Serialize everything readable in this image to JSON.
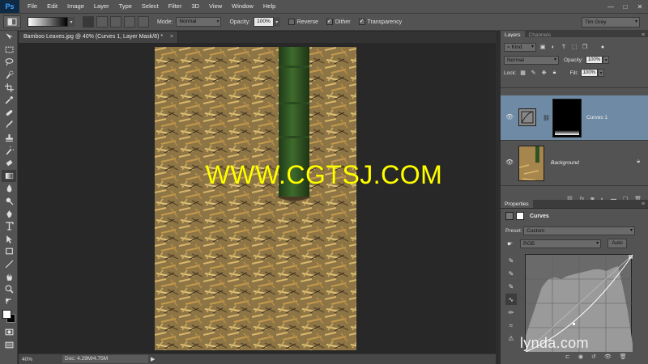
{
  "app": {
    "logo": "Ps",
    "menus": [
      "File",
      "Edit",
      "Image",
      "Layer",
      "Type",
      "Select",
      "Filter",
      "3D",
      "View",
      "Window",
      "Help"
    ],
    "window_controls": [
      "—",
      "□",
      "✕"
    ]
  },
  "options_bar": {
    "mode_label": "Mode:",
    "mode_value": "Normal",
    "opacity_label": "Opacity:",
    "opacity_value": "100%",
    "reverse_label": "Reverse",
    "reverse_checked": false,
    "dither_label": "Dither",
    "dither_checked": true,
    "transparency_label": "Transparency",
    "transparency_checked": true,
    "workspace": "Tim Grey"
  },
  "document": {
    "tab_title": "Bamboo Leaves.jpg @ 40% (Curves 1, Layer Mask/8) *",
    "tab_close": "×",
    "zoom": "40%",
    "doc_size": "Doc: 4.29M/4.75M",
    "status_arrow": "▶"
  },
  "watermark": "WWW.CGTSJ.COM",
  "colors": {
    "foreground": "#ffffff",
    "background": "#000000",
    "selected_layer": "#6f8aa5",
    "watermark": "#ffff00"
  },
  "layers_panel": {
    "tabs": [
      "Layers",
      "Channels"
    ],
    "filter_kind": "Kind",
    "blend_mode": "Normal",
    "opacity_label": "Opacity:",
    "opacity_value": "100%",
    "lock_label": "Lock:",
    "fill_label": "Fill:",
    "fill_value": "100%",
    "layers": [
      {
        "name": "Curves 1",
        "visible": true,
        "selected": true
      },
      {
        "name": "Background",
        "visible": true,
        "selected": false,
        "locked": true
      }
    ],
    "footer_icons": [
      "link-icon",
      "fx-icon",
      "mask-icon",
      "adjustment-icon",
      "folder-icon",
      "new-layer-icon",
      "trash-icon"
    ]
  },
  "properties_panel": {
    "tab": "Properties",
    "title": "Curves",
    "preset_label": "Preset:",
    "preset_value": "Custom",
    "channel_value": "RGB",
    "auto_label": "Auto"
  },
  "branding": "lynda.com"
}
